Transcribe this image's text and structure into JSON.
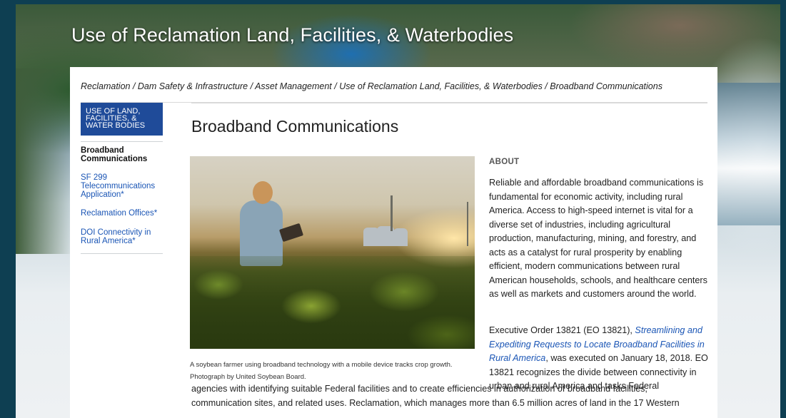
{
  "site": {
    "title": "Use of Reclamation Land, Facilities, & Waterbodies"
  },
  "breadcrumb": "Reclamation / Dam Safety & Infrastructure / Asset Management / Use of Reclamation Land, Facilities, & Waterbodies / Broadband Communications",
  "sidenav": {
    "header": "USE OF LAND, FACILITIES, & WATER BODIES",
    "items": [
      {
        "label": "Broadband Communications",
        "active": true
      },
      {
        "label": "SF 299 Telecommunications Application*",
        "active": false
      },
      {
        "label": "Reclamation Offices*",
        "active": false
      },
      {
        "label": "DOI Connectivity in Rural America*",
        "active": false
      }
    ]
  },
  "page": {
    "title": "Broadband Communications",
    "caption_line1": "A soybean farmer using broadband technology with a mobile device tracks crop growth.",
    "caption_line2": "Photograph by United Soybean Board.",
    "about_heading": "ABOUT",
    "about_text": "Reliable and affordable broadband communications is fundamental for economic activity, including rural America. Access to high-speed internet is vital for a diverse set of industries, including agricultural production, manufacturing, mining, and forestry, and acts as a catalyst for rural prosperity by enabling efficient, modern communications between rural American households, schools, and healthcare centers as well as markets and customers around the world.",
    "eo_prefix": "Executive Order 13821 (EO 13821), ",
    "eo_link": "Streamlining and Expediting Requests to Locate Broadband Facilities in Rural America",
    "eo_suffix": ", was executed on January 18, 2018. EO 13821 recognizes the divide between connectivity in urban and rural America and tasks Federal",
    "continued_text": "agencies with identifying suitable Federal facilities and to create efficiencies in authorization of broadband facilities, communication sites, and related uses. Reclamation, which manages more than 6.5 million acres of land in the 17 Western"
  }
}
